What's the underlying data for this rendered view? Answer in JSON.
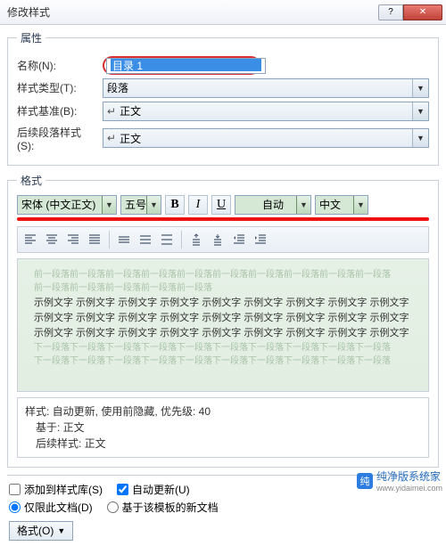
{
  "titlebar": {
    "title": "修改样式"
  },
  "groups": {
    "props": "属性",
    "format": "格式"
  },
  "props": {
    "name_label": "名称(N):",
    "name_value": "目录 1",
    "type_label": "样式类型(T):",
    "type_value": "段落",
    "based_label": "样式基准(B):",
    "based_value": "正文",
    "next_label": "后续段落样式(S):",
    "next_value": "正文"
  },
  "fmt": {
    "font": "宋体 (中文正文)",
    "size": "五号",
    "bold": "B",
    "italic": "I",
    "underline": "U",
    "color": "自动",
    "script": "中文"
  },
  "preview": {
    "ghost_before": "前一段落前一段落前一段落前一段落前一段落前一段落前一段落前一段落前一段落前一段落",
    "ghost_before2": "前一段落前一段落前一段落前一段落前一段落",
    "sample": "示例文字 示例文字 示例文字 示例文字 示例文字 示例文字 示例文字 示例文字 示例文字",
    "ghost_after": "下一段落下一段落下一段落下一段落下一段落下一段落下一段落下一段落下一段落下一段落",
    "ghost_after2": "下一段落下一段落下一段落下一段落下一段落下一段落下一段落下一段落下一段落下一段落"
  },
  "info": {
    "line1": "样式: 自动更新, 使用前隐藏, 优先级: 40",
    "line2": "基于: 正文",
    "line3": "后续样式: 正文"
  },
  "opts": {
    "add_gallery": "添加到样式库(S)",
    "auto_update": "自动更新(U)",
    "only_doc": "仅限此文档(D)",
    "template": "基于该模板的新文档"
  },
  "buttons": {
    "format": "格式(O)"
  },
  "watermark": {
    "name": "纯净版系统家",
    "url": "www.yidaimei.com"
  }
}
